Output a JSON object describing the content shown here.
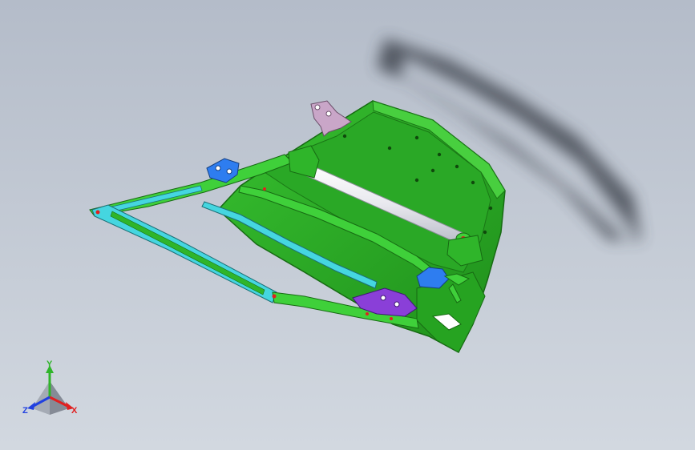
{
  "viewport": {
    "background_top": "#b4bcc9",
    "background_bottom": "#d2d8e0"
  },
  "model": {
    "colors": {
      "panel": "#2fb52a",
      "panel_dark": "#1e8a1a",
      "rail": "#3fd03a",
      "rail_cyan": "#45d6e0",
      "rod": "#f4f4f6",
      "bracket_blue": "#2e7df0",
      "bracket_pink": "#c9a6c8",
      "bracket_purple": "#8a3fd8",
      "shadow": "#3a3f48"
    }
  },
  "triad": {
    "y_label": "Y",
    "x_label": "X",
    "z_label": "Z",
    "y_color": "#2fb52a",
    "x_color": "#e02020",
    "z_color": "#2040e0"
  }
}
